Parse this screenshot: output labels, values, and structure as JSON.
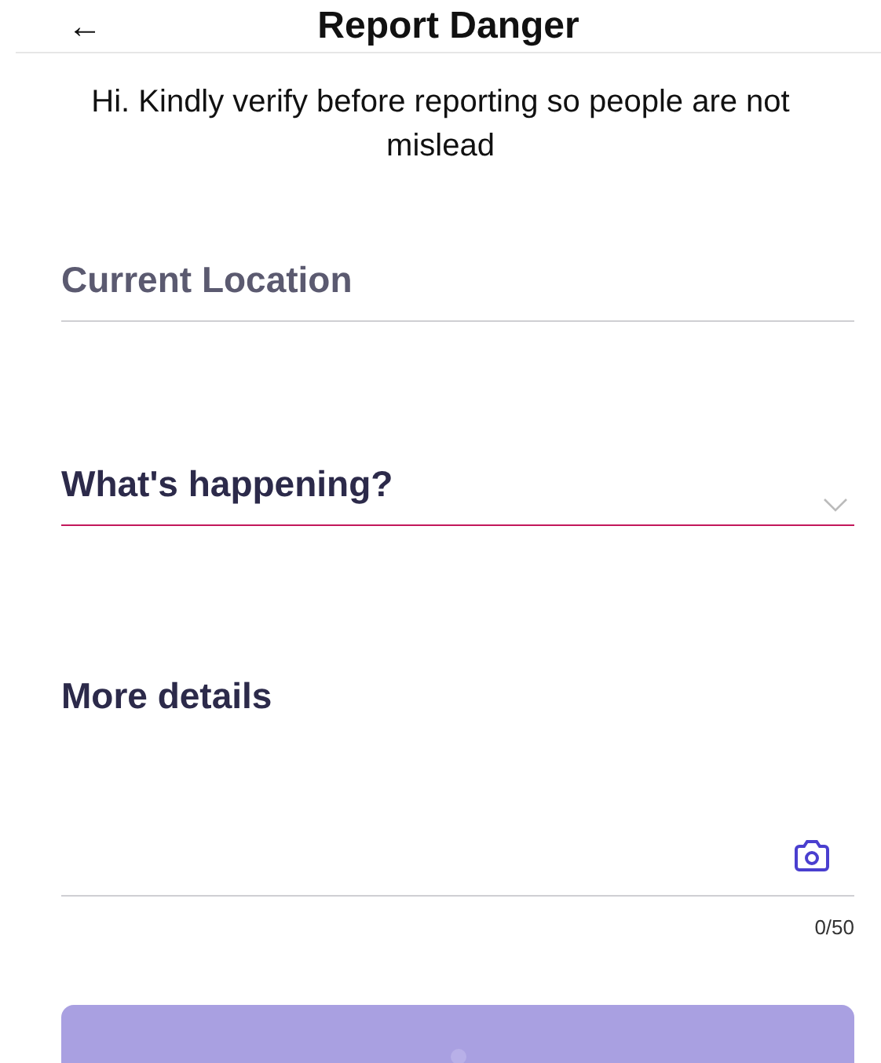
{
  "header": {
    "back_icon": "←",
    "title": "Report Danger"
  },
  "intro": "Hi. Kindly verify before reporting so people are not mislead",
  "fields": [
    {
      "kind": "text",
      "placeholder": "Current Location",
      "focused": false
    },
    {
      "kind": "dropdown",
      "placeholder": "What's happening?",
      "focused": true
    },
    {
      "kind": "textarea",
      "placeholder": "More details",
      "focused": false,
      "counter": "0/50"
    }
  ],
  "submit_button": {
    "disabled": true,
    "loading": true
  }
}
